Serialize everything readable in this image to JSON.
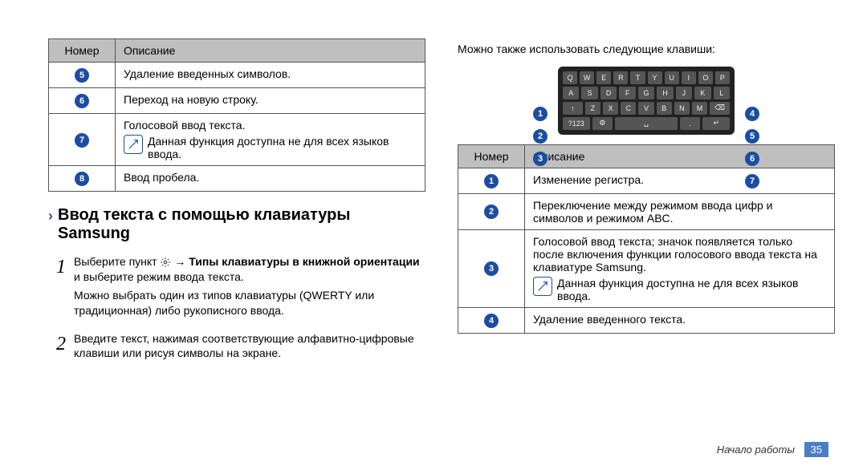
{
  "left": {
    "table": {
      "header": {
        "num": "Номер",
        "desc": "Описание"
      },
      "rows": [
        {
          "n": "5",
          "desc": "Удаление введенных символов."
        },
        {
          "n": "6",
          "desc": "Переход на новую строку."
        },
        {
          "n": "7",
          "desc": "Голосовой ввод текста.",
          "note": "Данная функция доступна не для всех языков ввода."
        },
        {
          "n": "8",
          "desc": "Ввод пробела."
        }
      ]
    },
    "section_title": "Ввод текста с помощью клавиатуры Samsung",
    "steps": [
      {
        "n": "1",
        "pre": "Выберите пункт ",
        "mid": " → ",
        "bold": "Типы клавиатуры в книжной ориентации",
        "post": " и выберите режим ввода текста.",
        "extra": "Можно выбрать один из типов клавиатуры (QWERTY или традиционная) либо рукописного ввода."
      },
      {
        "n": "2",
        "pre": "Введите текст, нажимая соответствующие алфавитно-цифровые клавиши или рисуя символы на экране."
      }
    ]
  },
  "right": {
    "intro": "Можно также использовать следующие клавиши:",
    "keyboard": {
      "row1": [
        "Q",
        "W",
        "E",
        "R",
        "T",
        "Y",
        "U",
        "I",
        "O",
        "P"
      ],
      "row2": [
        "A",
        "S",
        "D",
        "F",
        "G",
        "H",
        "J",
        "K",
        "L"
      ],
      "row3": [
        "↑",
        "Z",
        "X",
        "C",
        "V",
        "B",
        "N",
        "M",
        "⌫"
      ],
      "row4": [
        "?123",
        "⚙",
        "␣",
        ".",
        "↵"
      ]
    },
    "callouts_left": [
      "1",
      "2",
      "3"
    ],
    "callouts_right": [
      "4",
      "5",
      "6",
      "7"
    ],
    "table": {
      "header": {
        "num": "Номер",
        "desc": "Описание"
      },
      "rows": [
        {
          "n": "1",
          "desc": "Изменение регистра."
        },
        {
          "n": "2",
          "desc": "Переключение между режимом ввода цифр и символов и режимом ABC."
        },
        {
          "n": "3",
          "desc": "Голосовой ввод текста; значок появляется только после включения функции голосового ввода текста на клавиатуре Samsung.",
          "note": "Данная функция доступна не для всех языков ввода."
        },
        {
          "n": "4",
          "desc": "Удаление введенного текста."
        }
      ]
    }
  },
  "footer": {
    "label": "Начало работы",
    "page": "35"
  }
}
